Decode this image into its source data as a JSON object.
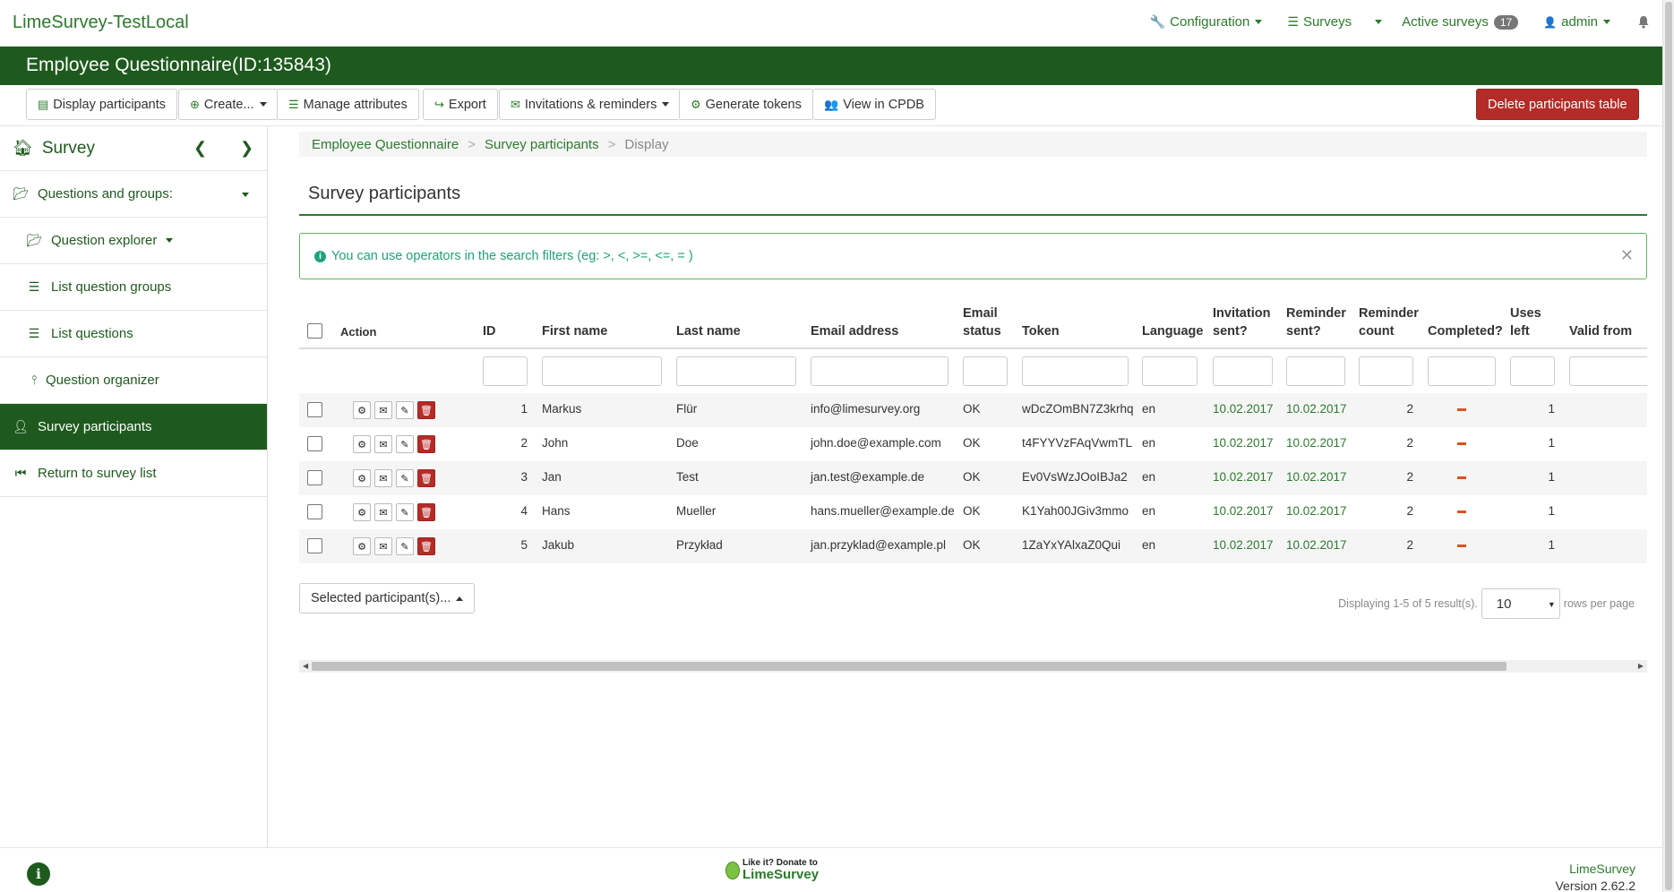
{
  "app": {
    "brand": "LimeSurvey-TestLocal",
    "nav": {
      "configuration": "Configuration",
      "surveys": "Surveys",
      "active_surveys": "Active surveys",
      "active_count": "17",
      "user": "admin"
    }
  },
  "title": "Employee Questionnaire(ID:135843)",
  "toolbar": {
    "display_participants": "Display participants",
    "create": "Create...",
    "manage_attributes": "Manage attributes",
    "export": "Export",
    "invitations": "Invitations & reminders",
    "generate_tokens": "Generate tokens",
    "view_cpdb": "View in CPDB",
    "delete_table": "Delete participants table"
  },
  "sidebar": {
    "header": "Survey",
    "items": [
      {
        "label": "Questions and groups:"
      },
      {
        "label": "Question explorer"
      },
      {
        "label": "List question groups"
      },
      {
        "label": "List questions"
      },
      {
        "label": "Question organizer"
      },
      {
        "label": "Survey participants"
      },
      {
        "label": "Return to survey list"
      }
    ]
  },
  "breadcrumb": {
    "b1": "Employee Questionnaire",
    "b2": "Survey participants",
    "b3": "Display"
  },
  "page_title": "Survey participants",
  "alert": "You can use operators in the search filters (eg: >, <, >=, <=, = )",
  "table": {
    "headers": {
      "action": "Action",
      "id": "ID",
      "first_name": "First name",
      "last_name": "Last name",
      "email": "Email address",
      "email_status_1": "Email",
      "email_status_2": "status",
      "token": "Token",
      "language": "Language",
      "inv_1": "Invitation",
      "inv_2": "sent?",
      "rem_1": "Reminder",
      "rem_2": "sent?",
      "remc_1": "Reminder",
      "remc_2": "count",
      "completed": "Completed?",
      "uses_1": "Uses",
      "uses_2": "left",
      "valid_from": "Valid from"
    },
    "rows": [
      {
        "id": "1",
        "first": "Markus",
        "last": "Flür",
        "email": "info@limesurvey.org",
        "status": "OK",
        "token": "wDcZOmBN7Z3krhq",
        "lang": "en",
        "inv": "10.02.2017",
        "rem": "10.02.2017",
        "remc": "2",
        "uses": "1"
      },
      {
        "id": "2",
        "first": "John",
        "last": "Doe",
        "email": "john.doe@example.com",
        "status": "OK",
        "token": "t4FYYVzFAqVwmTL",
        "lang": "en",
        "inv": "10.02.2017",
        "rem": "10.02.2017",
        "remc": "2",
        "uses": "1"
      },
      {
        "id": "3",
        "first": "Jan",
        "last": "Test",
        "email": "jan.test@example.de",
        "status": "OK",
        "token": "Ev0VsWzJOoIBJa2",
        "lang": "en",
        "inv": "10.02.2017",
        "rem": "10.02.2017",
        "remc": "2",
        "uses": "1"
      },
      {
        "id": "4",
        "first": "Hans",
        "last": "Mueller",
        "email": "hans.mueller@example.de",
        "status": "OK",
        "token": "K1Yah00JGiv3mmo",
        "lang": "en",
        "inv": "10.02.2017",
        "rem": "10.02.2017",
        "remc": "2",
        "uses": "1"
      },
      {
        "id": "5",
        "first": "Jakub",
        "last": "Przykład",
        "email": "jan.przyklad@example.pl",
        "status": "OK",
        "token": "1ZaYxYAlxaZ0Qui",
        "lang": "en",
        "inv": "10.02.2017",
        "rem": "10.02.2017",
        "remc": "2",
        "uses": "1"
      }
    ]
  },
  "selected_btn": "Selected participant(s)...",
  "pager": {
    "summary": "Displaying 1-5 of 5 result(s).",
    "page_size": "10",
    "rows_per_page": "rows per page"
  },
  "footer": {
    "donate_1": "Like it? Donate to",
    "donate_2": "LimeSurvey",
    "product": "LimeSurvey",
    "version": "Version 2.62.2"
  }
}
